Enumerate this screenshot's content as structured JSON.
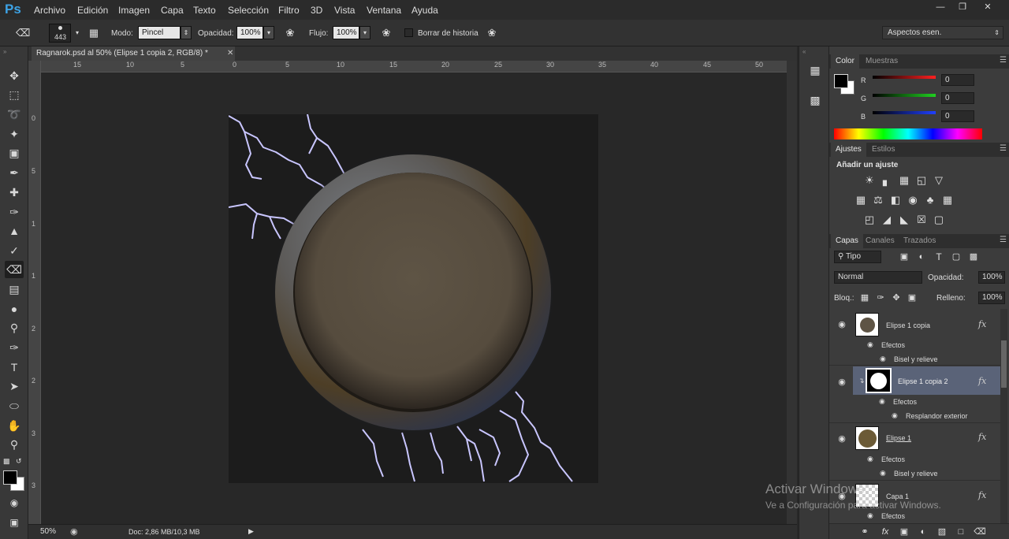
{
  "app": {
    "logo": "Ps"
  },
  "menu": [
    "Archivo",
    "Edición",
    "Imagen",
    "Capa",
    "Texto",
    "Selección",
    "Filtro",
    "3D",
    "Vista",
    "Ventana",
    "Ayuda"
  ],
  "window_controls": [
    "minimize-icon",
    "restore-icon",
    "close-icon"
  ],
  "options": {
    "brush_size": "443",
    "mode_label": "Modo:",
    "mode_value": "Pincel",
    "opacity_label": "Opacidad:",
    "opacity_value": "100%",
    "flow_label": "Flujo:",
    "flow_value": "100%",
    "erase_history_label": "Borrar de historia",
    "workspace": "Aspectos esen."
  },
  "document": {
    "tab_title": "Ragnarok.psd al 50% (Elipse 1 copia 2, RGB/8) *",
    "zoom": "50%",
    "doc_info": "Doc: 2,86 MB/10,3 MB"
  },
  "rulers": {
    "top": [
      "15",
      "10",
      "5",
      "0",
      "5",
      "10",
      "15",
      "20",
      "25",
      "30",
      "35",
      "40",
      "45",
      "50"
    ],
    "left": [
      "0",
      "5",
      "1",
      "1",
      "2",
      "2",
      "3",
      "3"
    ]
  },
  "color_panel": {
    "tabs": [
      "Color",
      "Muestras"
    ],
    "channels": [
      {
        "label": "R",
        "value": "0",
        "color": "#ff2020"
      },
      {
        "label": "G",
        "value": "0",
        "color": "#20d020"
      },
      {
        "label": "B",
        "value": "0",
        "color": "#2040ff"
      }
    ]
  },
  "adjustments_panel": {
    "tabs": [
      "Ajustes",
      "Estilos"
    ],
    "title": "Añadir un ajuste",
    "icons": [
      "brightness-icon",
      "levels-icon",
      "curves-icon",
      "exposure-icon",
      "vibrance-icon",
      "hue-saturation-icon",
      "color-balance-icon",
      "black-white-icon",
      "photo-filter-icon",
      "channel-mixer-icon",
      "color-lookup-icon",
      "invert-icon",
      "posterize-icon",
      "threshold-icon",
      "selective-color-icon",
      "gradient-map-icon"
    ]
  },
  "layers_panel": {
    "tabs": [
      "Capas",
      "Canales",
      "Trazados"
    ],
    "filter_label": "Tipo",
    "blend_mode": "Normal",
    "opacity_label": "Opacidad:",
    "opacity_value": "100%",
    "lock_label": "Bloq.:",
    "fill_label": "Relleno:",
    "fill_value": "100%",
    "layers": [
      {
        "name": "Elipse 1 copia",
        "effects_label": "Efectos",
        "effect": "Bisel y relieve"
      },
      {
        "name": "Elipse 1 copia 2",
        "effects_label": "Efectos",
        "effect": "Resplandor exterior"
      },
      {
        "name": "Elipse 1",
        "effects_label": "Efectos",
        "effect": "Bisel y relieve"
      },
      {
        "name": "Capa 1",
        "effects_label": "Efectos"
      }
    ]
  },
  "watermark": {
    "line1": "Activar Windows",
    "line2": "Ve a Configuración para activar Windows."
  },
  "colors": {
    "accent": "#3da3e6",
    "selected_layer": "#5a6378",
    "canvas_bg": "#1c1c1c"
  }
}
